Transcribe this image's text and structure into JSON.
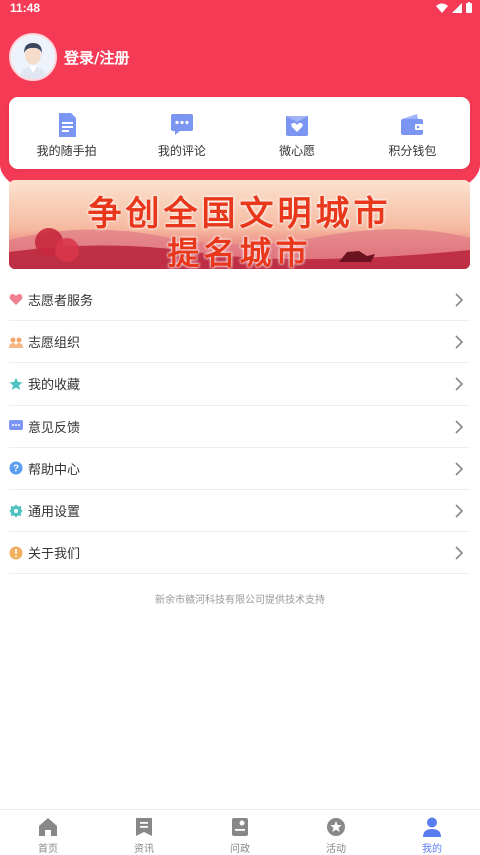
{
  "status_bar": {
    "time": "11:48"
  },
  "profile": {
    "login_label": "登录/注册"
  },
  "quick_actions": [
    {
      "label": "我的随手拍",
      "icon": "document-icon"
    },
    {
      "label": "我的评论",
      "icon": "comment-icon"
    },
    {
      "label": "微心愿",
      "icon": "heart-box-icon"
    },
    {
      "label": "积分钱包",
      "icon": "wallet-icon"
    }
  ],
  "banner": {
    "line1": "争创全国文明城市",
    "line2": "提名城市"
  },
  "menu": [
    {
      "label": "志愿者服务",
      "icon": "heart-icon"
    },
    {
      "label": "志愿组织",
      "icon": "group-icon"
    },
    {
      "label": "我的收藏",
      "icon": "star-icon"
    },
    {
      "label": "意见反馈",
      "icon": "feedback-icon"
    },
    {
      "label": "帮助中心",
      "icon": "help-icon"
    },
    {
      "label": "通用设置",
      "icon": "settings-icon"
    },
    {
      "label": "关于我们",
      "icon": "info-icon"
    }
  ],
  "footer_note": "新余市赣河科技有限公司提供技术支持",
  "tabs": [
    {
      "label": "首页",
      "icon": "home-icon",
      "active": false
    },
    {
      "label": "资讯",
      "icon": "news-icon",
      "active": false
    },
    {
      "label": "问政",
      "icon": "inquiry-icon",
      "active": false
    },
    {
      "label": "活动",
      "icon": "activity-icon",
      "active": false
    },
    {
      "label": "我的",
      "icon": "profile-icon",
      "active": true
    }
  ],
  "colors": {
    "header": "#f53a55",
    "accent": "#5b7cf0",
    "icon_blue": "#7b96f2"
  }
}
